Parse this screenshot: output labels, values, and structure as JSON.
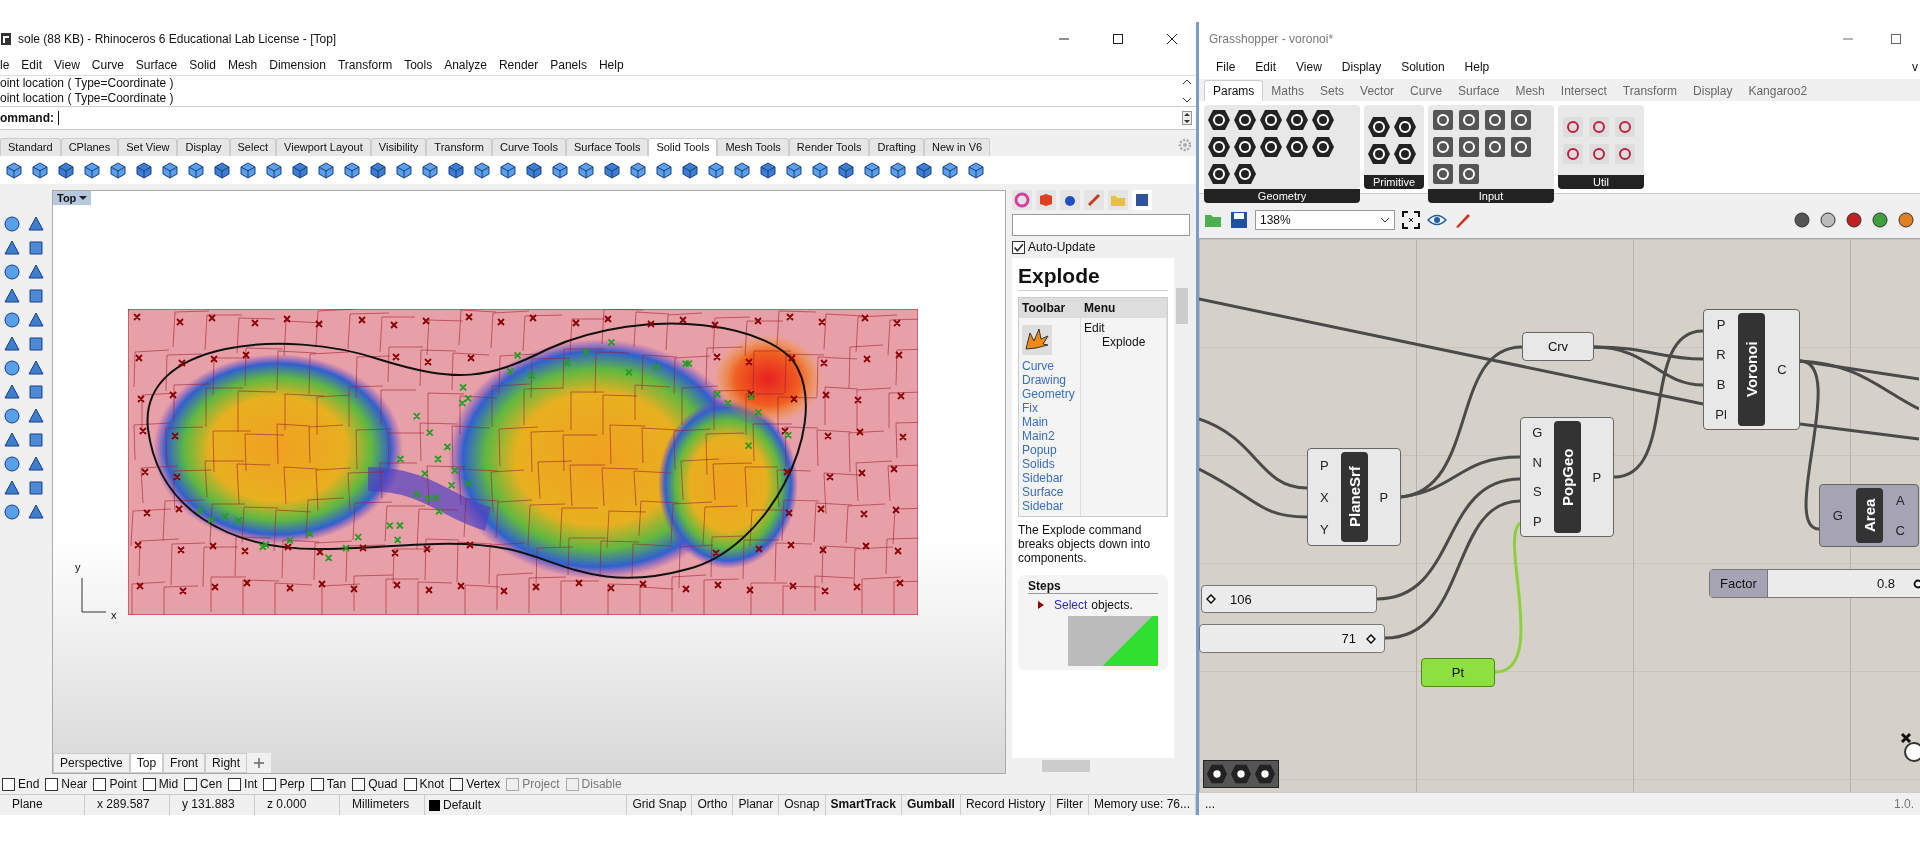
{
  "rhino": {
    "title": "sole (88 KB) - Rhinoceros 6 Educational Lab License - [Top]",
    "menu": [
      "le",
      "Edit",
      "View",
      "Curve",
      "Surface",
      "Solid",
      "Mesh",
      "Dimension",
      "Transform",
      "Tools",
      "Analyze",
      "Render",
      "Panels",
      "Help"
    ],
    "command_history": [
      "oint location ( Type=Coordinate )",
      "oint location ( Type=Coordinate )"
    ],
    "command_prompt": "ommand:",
    "toolbar_tabs": [
      {
        "label": "Standard",
        "selected": false
      },
      {
        "label": "CPlanes",
        "selected": false
      },
      {
        "label": "Set View",
        "selected": false
      },
      {
        "label": "Display",
        "selected": false
      },
      {
        "label": "Select",
        "selected": false
      },
      {
        "label": "Viewport Layout",
        "selected": false
      },
      {
        "label": "Visibility",
        "selected": false
      },
      {
        "label": "Transform",
        "selected": false
      },
      {
        "label": "Curve Tools",
        "selected": false
      },
      {
        "label": "Surface Tools",
        "selected": false
      },
      {
        "label": "Solid Tools",
        "selected": true
      },
      {
        "label": "Mesh Tools",
        "selected": false
      },
      {
        "label": "Render Tools",
        "selected": false
      },
      {
        "label": "Drafting",
        "selected": false
      },
      {
        "label": "New in V6",
        "selected": false
      }
    ],
    "viewport": {
      "label": "Top",
      "axis_x": "x",
      "axis_y": "y"
    },
    "viewport_tabs": [
      {
        "label": "Perspective",
        "selected": false
      },
      {
        "label": "Top",
        "selected": true
      },
      {
        "label": "Front",
        "selected": false
      },
      {
        "label": "Right",
        "selected": false
      }
    ],
    "osnaps": [
      {
        "label": "End",
        "checked": false,
        "disabled": false
      },
      {
        "label": "Near",
        "checked": false,
        "disabled": false
      },
      {
        "label": "Point",
        "checked": false,
        "disabled": false
      },
      {
        "label": "Mid",
        "checked": false,
        "disabled": false
      },
      {
        "label": "Cen",
        "checked": false,
        "disabled": false
      },
      {
        "label": "Int",
        "checked": false,
        "disabled": false
      },
      {
        "label": "Perp",
        "checked": false,
        "disabled": false
      },
      {
        "label": "Tan",
        "checked": false,
        "disabled": false
      },
      {
        "label": "Quad",
        "checked": false,
        "disabled": false
      },
      {
        "label": "Knot",
        "checked": false,
        "disabled": false
      },
      {
        "label": "Vertex",
        "checked": false,
        "disabled": false
      },
      {
        "label": "Project",
        "checked": false,
        "disabled": true
      },
      {
        "label": "Disable",
        "checked": false,
        "disabled": true
      }
    ],
    "status_fields": [
      "Plane",
      "x 289.587",
      "y 131.883",
      "z 0.000",
      "Millimeters"
    ],
    "layer": {
      "name": "Default",
      "color": "#000000"
    },
    "status_toggles": [
      {
        "label": "Grid Snap",
        "on": false
      },
      {
        "label": "Ortho",
        "on": false
      },
      {
        "label": "Planar",
        "on": false
      },
      {
        "label": "Osnap",
        "on": false
      },
      {
        "label": "SmartTrack",
        "on": true
      },
      {
        "label": "Gumball",
        "on": true
      },
      {
        "label": "Record History",
        "on": false
      },
      {
        "label": "Filter",
        "on": false
      }
    ],
    "memory": "Memory use: 76...",
    "help_panel": {
      "auto_update": {
        "label": "Auto-Update",
        "checked": true
      },
      "heading": "Explode",
      "columns": [
        "Toolbar",
        "Menu"
      ],
      "toolbar_links": [
        "Curve",
        "Drawing",
        "Geometry",
        "Fix",
        "Main",
        "Main2",
        "Popup",
        "Solids",
        "Sidebar",
        "Surface",
        "Sidebar"
      ],
      "menu_path": [
        "Edit",
        "Explode"
      ],
      "description": "The Explode command breaks objects down into components.",
      "steps_heading": "Steps",
      "step_link": "Select",
      "step_text": "objects."
    }
  },
  "grasshopper": {
    "title": "Grasshopper - voronoi*",
    "menu": [
      "File",
      "Edit",
      "View",
      "Display",
      "Solution",
      "Help"
    ],
    "menu_cut": "v",
    "tabs": [
      {
        "label": "Params",
        "selected": true
      },
      {
        "label": "Maths",
        "selected": false
      },
      {
        "label": "Sets",
        "selected": false
      },
      {
        "label": "Vector",
        "selected": false
      },
      {
        "label": "Curve",
        "selected": false
      },
      {
        "label": "Surface",
        "selected": false
      },
      {
        "label": "Mesh",
        "selected": false
      },
      {
        "label": "Intersect",
        "selected": false
      },
      {
        "label": "Transform",
        "selected": false
      },
      {
        "label": "Display",
        "selected": false
      },
      {
        "label": "Kangaroo2",
        "selected": false
      }
    ],
    "ribbon_groups": [
      "Geometry",
      "Primitive",
      "Input",
      "Util"
    ],
    "zoom": "138%",
    "components": [
      {
        "name": "PlaneSrf",
        "inputs": [
          "P",
          "X",
          "Y"
        ],
        "outputs": [
          "P"
        ],
        "preview": true
      },
      {
        "name": "PopGeo",
        "inputs": [
          "G",
          "N",
          "S",
          "P"
        ],
        "outputs": [
          "P"
        ],
        "preview": true
      },
      {
        "name": "Voronoi",
        "inputs": [
          "P",
          "R",
          "B",
          "Pl"
        ],
        "outputs": [
          "C"
        ],
        "preview": true
      },
      {
        "name": "Area",
        "inputs": [
          "G"
        ],
        "outputs": [
          "A",
          "C"
        ],
        "preview": false
      }
    ],
    "params": [
      {
        "label": "Crv",
        "selected": false
      },
      {
        "label": "Pt",
        "selected": true
      }
    ],
    "sliders": [
      {
        "value": "106",
        "level": 0.05
      },
      {
        "value": "71",
        "level": 0.93
      },
      {
        "name": "Factor",
        "value": "0.8",
        "level": 0.97
      }
    ],
    "status": "...",
    "version": "1.0."
  }
}
